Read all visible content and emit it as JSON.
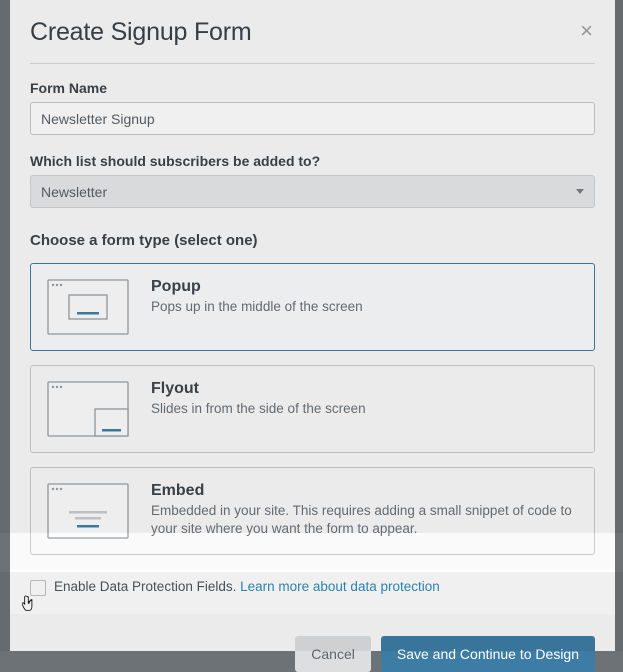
{
  "modal": {
    "title": "Create Signup Form",
    "close_icon": "×"
  },
  "fields": {
    "form_name": {
      "label": "Form Name",
      "value": "Newsletter Signup"
    },
    "list_select": {
      "label": "Which list should subscribers be added to?",
      "selected": "Newsletter"
    }
  },
  "form_type": {
    "heading": "Choose a form type (select one)",
    "options": [
      {
        "key": "popup",
        "title": "Popup",
        "desc": "Pops up in the middle of the screen",
        "selected": true
      },
      {
        "key": "flyout",
        "title": "Flyout",
        "desc": "Slides in from the side of the screen",
        "selected": false
      },
      {
        "key": "embed",
        "title": "Embed",
        "desc": "Embedded in your site. This requires adding a small snippet of code to your site where you want the form to appear.",
        "selected": false
      }
    ]
  },
  "data_protection": {
    "checked": false,
    "label": "Enable Data Protection Fields. ",
    "link_text": "Learn more about data protection"
  },
  "footer": {
    "cancel": "Cancel",
    "primary": "Save and Continue to Design"
  }
}
